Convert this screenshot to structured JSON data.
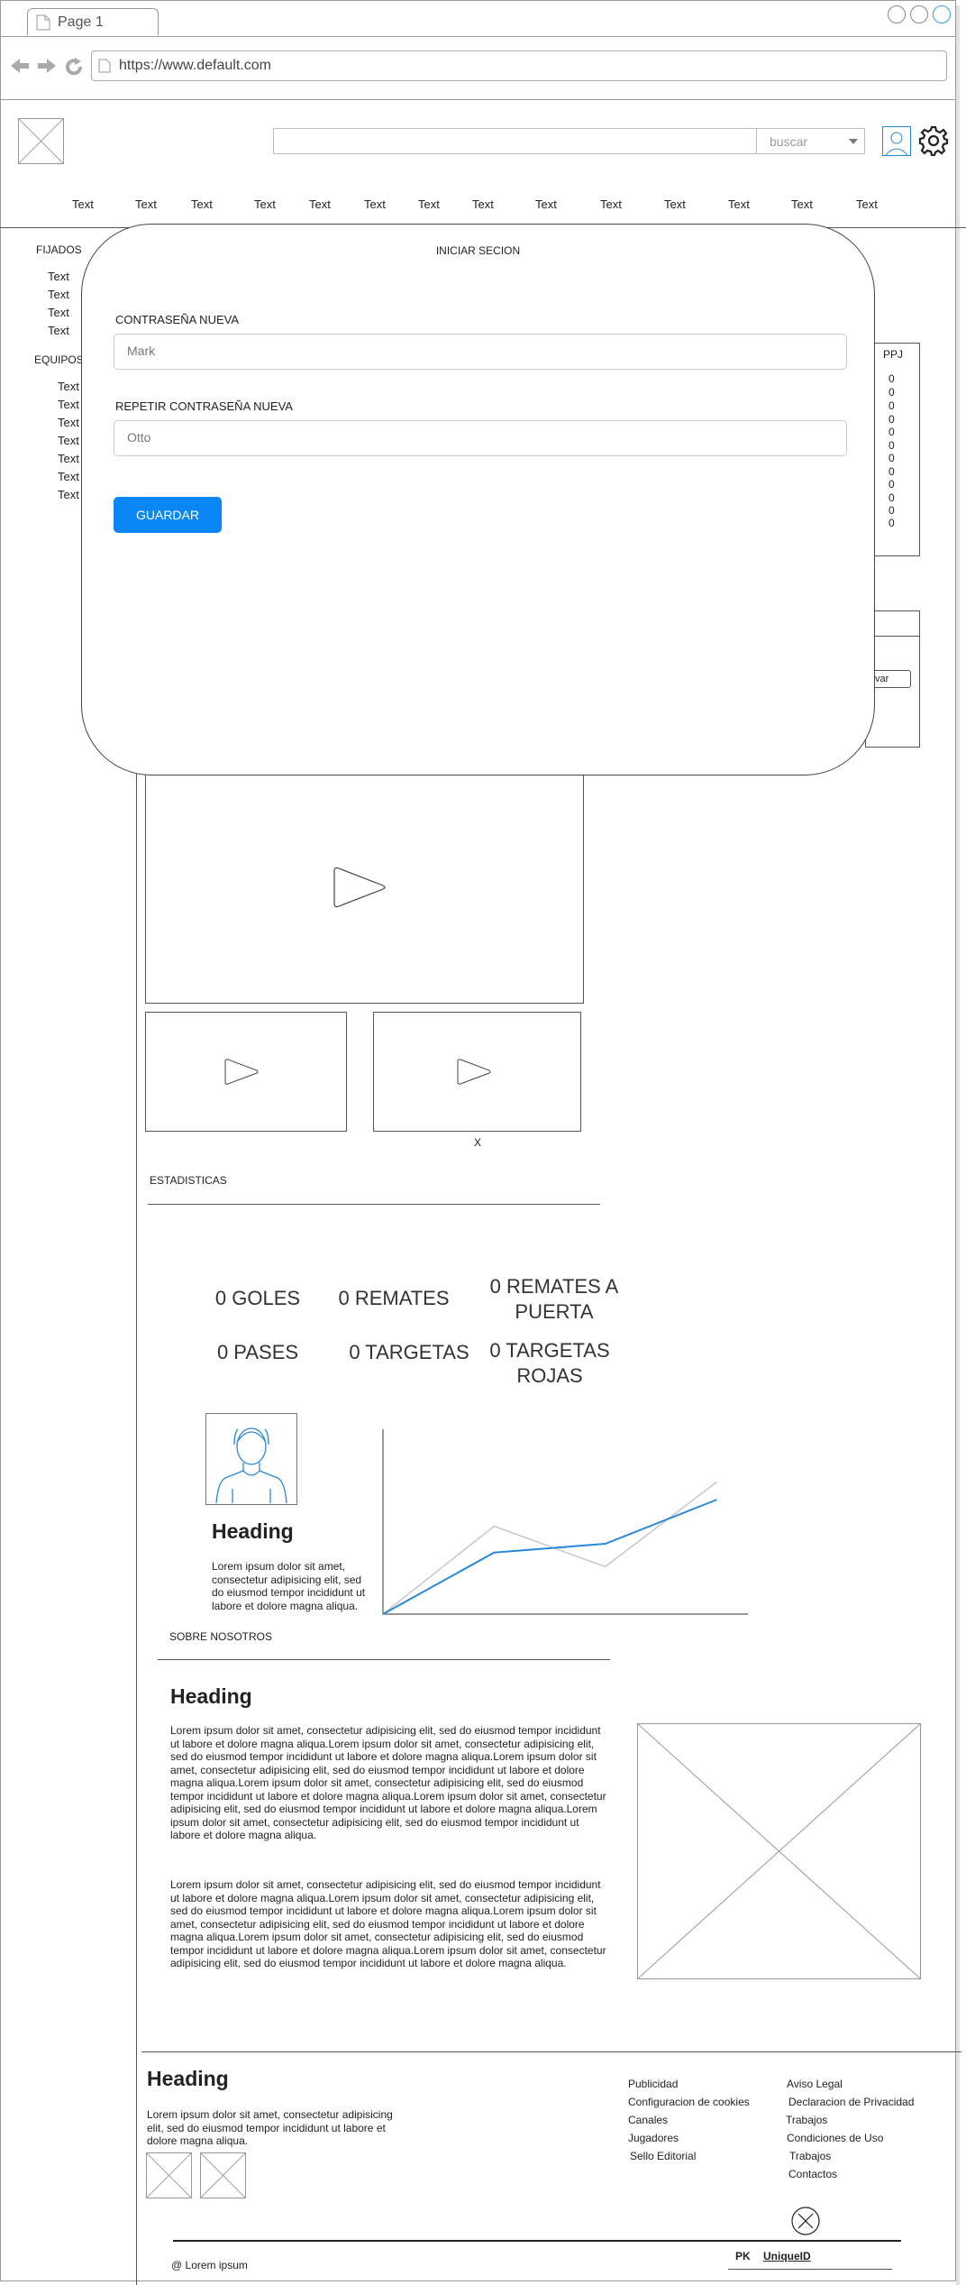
{
  "browser": {
    "tab_title": "Page 1",
    "url": "https://www.default.com"
  },
  "header": {
    "search_select": "buscar",
    "nav_items": [
      "Text",
      "Text",
      "Text",
      "Text",
      "Text",
      "Text",
      "Text",
      "Text",
      "Text",
      "Text",
      "Text",
      "Text",
      "Text",
      "Text"
    ]
  },
  "sidebar": {
    "fixed_title": "FIJADOS",
    "fixed_items": [
      "Text",
      "Text",
      "Text",
      "Text"
    ],
    "teams_title": "EQUIPOS",
    "team_items": [
      "Text",
      "Text",
      "Text",
      "Text",
      "Text",
      "Text",
      "Text"
    ]
  },
  "standings": {
    "header": "PPJ",
    "values": [
      "0",
      "0",
      "0",
      "0",
      "0",
      "0",
      "0",
      "0",
      "0",
      "0",
      "0",
      "0",
      "0"
    ],
    "partial_button": "var"
  },
  "modal": {
    "title": "INICIAR SECION",
    "field1_label": "CONTRASEÑA NUEVA",
    "field1_placeholder": "Mark",
    "field2_label": "REPETIR CONTRASEÑA NUEVA",
    "field2_placeholder": "Otto",
    "save_label": "GUARDAR"
  },
  "videos": {
    "close_label": "X"
  },
  "stats": {
    "title": "ESTADISTICAS",
    "goals": "0 GOLES",
    "shots": "0 REMATES",
    "shots_on_target_line1": "0 REMATES A",
    "shots_on_target_line2": "PUERTA",
    "passes": "0 PASES",
    "cards": "0 TARGETAS",
    "red_cards_line1": "0 TARGETAS",
    "red_cards_line2": "ROJAS"
  },
  "profile": {
    "heading": "Heading",
    "text": "Lorem ipsum dolor sit amet, consectetur adipisicing elit, sed do eiusmod tempor incididunt ut labore et dolore magna aliqua."
  },
  "chart_data": {
    "type": "line",
    "x": [
      0,
      1,
      2,
      3
    ],
    "series": [
      {
        "values": [
          0.0,
          0.35,
          0.4,
          0.65
        ],
        "color": "#2a88d8"
      },
      {
        "values": [
          0.0,
          0.5,
          0.27,
          0.75
        ],
        "color": "#c8c8c8"
      }
    ],
    "xlabel": "",
    "ylabel": "",
    "grid": false
  },
  "about": {
    "title": "SOBRE NOSOTROS",
    "heading": "Heading",
    "paragraph1": "Lorem ipsum dolor sit amet, consectetur adipisicing elit, sed do eiusmod tempor incididunt ut labore et dolore magna aliqua.Lorem ipsum dolor sit amet, consectetur adipisicing elit, sed do eiusmod tempor incididunt ut labore et dolore magna aliqua.Lorem ipsum dolor sit amet, consectetur adipisicing elit, sed do eiusmod tempor incididunt ut labore et dolore magna aliqua.Lorem ipsum dolor sit amet, consectetur adipisicing elit, sed do eiusmod tempor incididunt ut labore et dolore magna aliqua.Lorem ipsum dolor sit amet, consectetur adipisicing elit, sed do eiusmod tempor incididunt ut labore et dolore magna aliqua.Lorem ipsum dolor sit amet, consectetur adipisicing elit, sed do eiusmod tempor incididunt ut labore et dolore magna aliqua.",
    "paragraph2": "Lorem ipsum dolor sit amet, consectetur adipisicing elit, sed do eiusmod tempor incididunt ut labore et dolore magna aliqua.Lorem ipsum dolor sit amet, consectetur adipisicing elit, sed do eiusmod tempor incididunt ut labore et dolore magna aliqua.Lorem ipsum dolor sit amet, consectetur adipisicing elit, sed do eiusmod tempor incididunt ut labore et dolore magna aliqua.Lorem ipsum dolor sit amet, consectetur adipisicing elit, sed do eiusmod tempor incididunt ut labore et dolore magna aliqua.Lorem ipsum dolor sit amet, consectetur adipisicing elit, sed do eiusmod tempor incididunt ut labore et dolore magna aliqua."
  },
  "footer": {
    "heading": "Heading",
    "text": "Lorem ipsum dolor sit amet, consectetur adipisicing elit, sed do eiusmod tempor incididunt ut labore et dolore magna aliqua.",
    "col1": [
      "Publicidad",
      "Configuracion de cookies",
      "Canales",
      "Jugadores",
      "Sello Editorial"
    ],
    "col2": [
      "Aviso Legal",
      "Declaracion de Privacidad",
      "Trabajos",
      "Condiciones de Uso",
      "Trabajos",
      "Contactos"
    ],
    "copyright": "@ Lorem ipsum",
    "pk_label": "PK",
    "pk_value": "UniqueID"
  },
  "colors": {
    "accent": "#0b87f5",
    "line_primary": "#2a88d8",
    "line_secondary": "#c8c8c8"
  }
}
